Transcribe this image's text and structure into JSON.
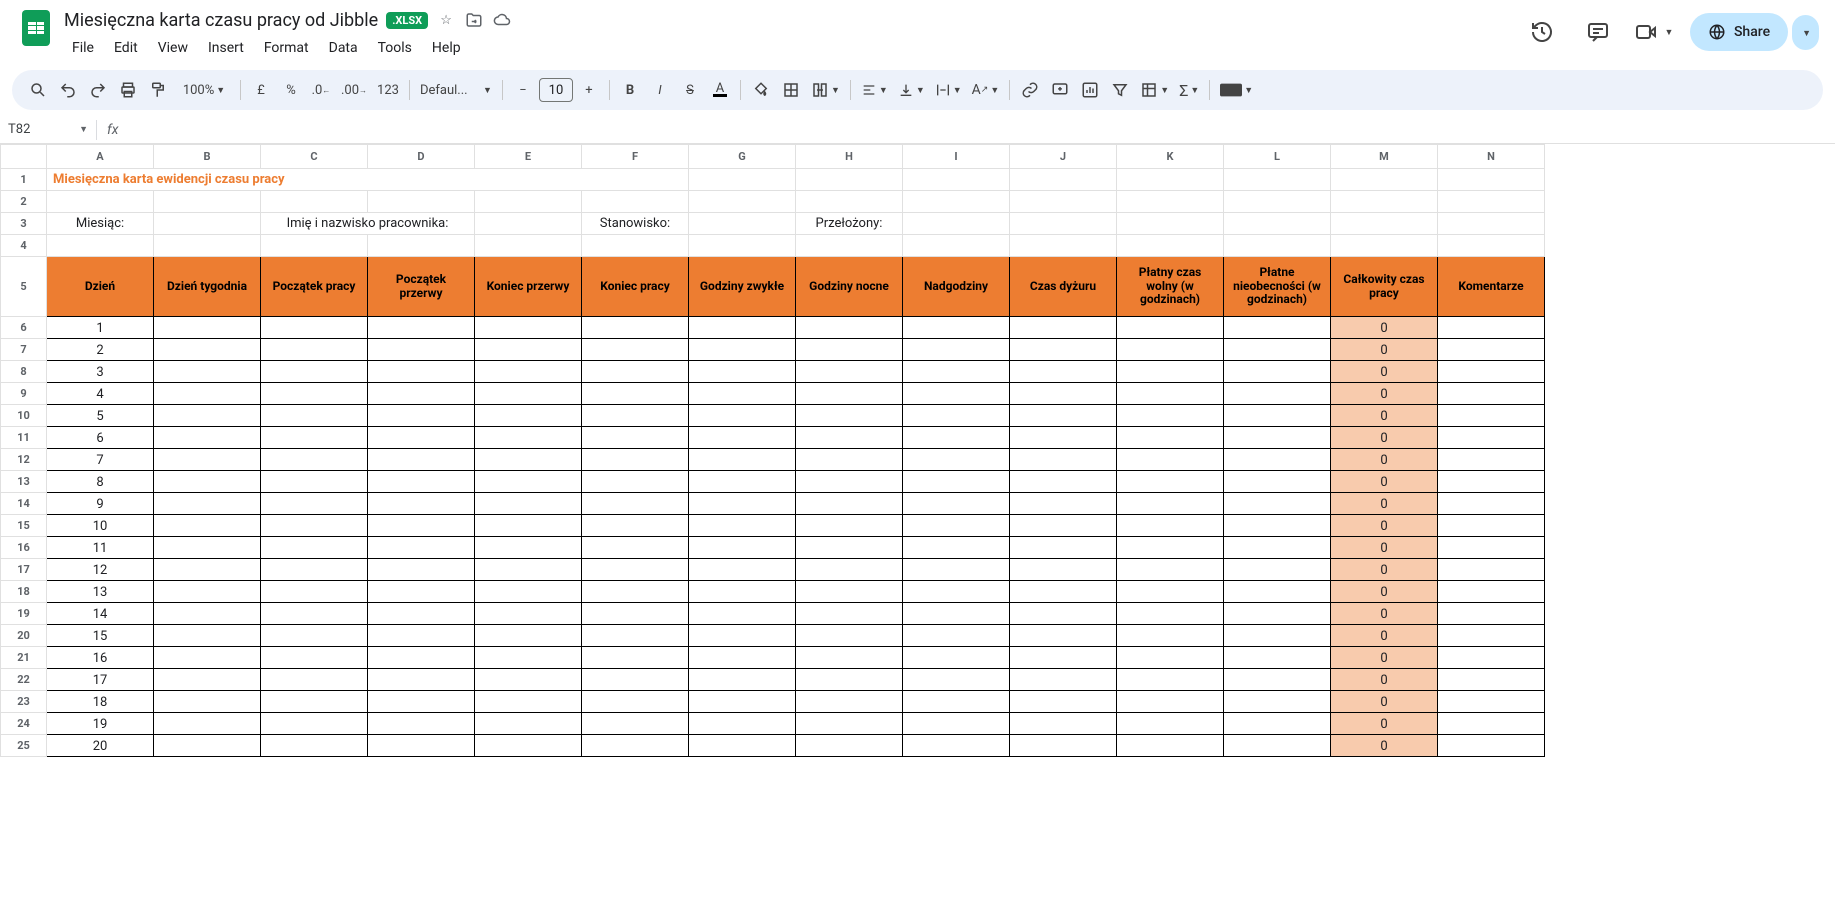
{
  "doc": {
    "title": "Miesięczna karta czasu pracy od Jibble",
    "badge": ".XLSX"
  },
  "menus": {
    "file": "File",
    "edit": "Edit",
    "view": "View",
    "insert": "Insert",
    "format": "Format",
    "data": "Data",
    "tools": "Tools",
    "help": "Help"
  },
  "share": {
    "label": "Share"
  },
  "toolbar": {
    "zoom": "100%",
    "font": "Defaul...",
    "fontSize": "10",
    "numfmt": "123",
    "currency": "£",
    "percent": "%"
  },
  "nameBox": "T82",
  "columns": [
    "A",
    "B",
    "C",
    "D",
    "E",
    "F",
    "G",
    "H",
    "I",
    "J",
    "K",
    "L",
    "M",
    "N"
  ],
  "rows": 25,
  "sheet": {
    "title": "Miesięczna karta ewidencji czasu pracy",
    "labels": {
      "month": "Miesiąc:",
      "name": "Imię i nazwisko pracownika:",
      "position": "Stanowisko:",
      "supervisor": "Przełożony:"
    },
    "headers": [
      "Dzień",
      "Dzień tygodnia",
      "Początek pracy",
      "Początek przerwy",
      "Koniec przerwy",
      "Koniec pracy",
      "Godziny zwykłe",
      "Godziny nocne",
      "Nadgodziny",
      "Czas dyżuru",
      "Płatny czas wolny\n(w godzinach)",
      "Płatne nieobecności (w godzinach)",
      "Całkowity czas pracy",
      "Komentarze"
    ],
    "days": [
      1,
      2,
      3,
      4,
      5,
      6,
      7,
      8,
      9,
      10,
      11,
      12,
      13,
      14,
      15,
      16,
      17,
      18,
      19,
      20
    ],
    "total": 0
  }
}
